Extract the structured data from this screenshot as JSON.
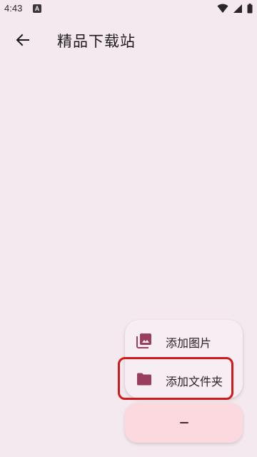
{
  "status_bar": {
    "time": "4:43",
    "notification_letter": "A",
    "icons": [
      "wifi-icon",
      "signal-icon",
      "battery-icon"
    ]
  },
  "app_bar": {
    "back_icon": "arrow-back-icon",
    "title": "精品下载站"
  },
  "fab_menu": {
    "items": [
      {
        "label": "添加图片",
        "icon": "images-icon"
      },
      {
        "label": "添加文件夹",
        "icon": "folder-icon"
      }
    ],
    "main_button_icon": "minus-icon"
  },
  "colors": {
    "background": "#f4e9ef",
    "accent": "#9a3e60",
    "fab": "#fcd9df",
    "highlight": "#d11a1a"
  }
}
